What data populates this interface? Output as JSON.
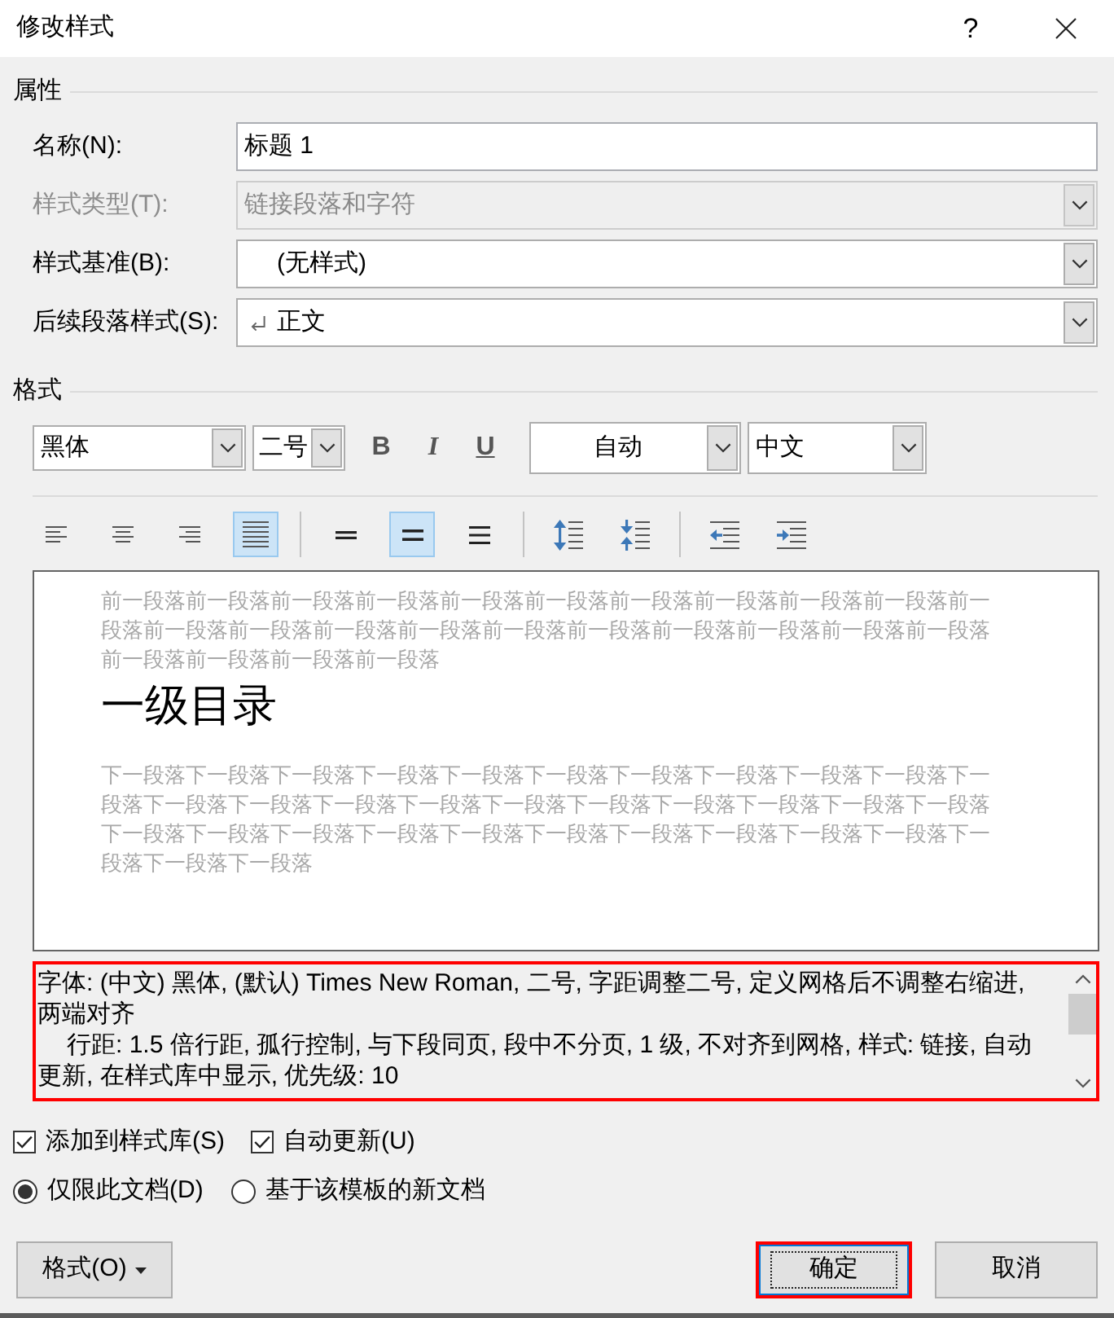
{
  "window": {
    "title": "修改样式",
    "help": "?"
  },
  "properties": {
    "heading": "属性",
    "fields": [
      {
        "kind": "text",
        "label": "名称(N):",
        "value": "标题 1",
        "disabled": false
      },
      {
        "kind": "combo",
        "label": "样式类型(T):",
        "value": "链接段落和字符",
        "disabled": true
      },
      {
        "kind": "style_combo",
        "label": "样式基准(B):",
        "value": "(无样式)",
        "disabled": false,
        "paragraph_style": false
      },
      {
        "kind": "style_combo",
        "label": "后续段落样式(S):",
        "value": "正文",
        "disabled": false,
        "paragraph_style": true
      }
    ]
  },
  "format": {
    "heading": "格式",
    "font": "黑体",
    "size": "二号",
    "styles": [
      {
        "kind": "bold",
        "label": "B",
        "selected": false
      },
      {
        "kind": "italic",
        "label": "I",
        "selected": false
      },
      {
        "kind": "underline",
        "label": "U",
        "selected": false
      }
    ],
    "font_color": "自动",
    "language": "中文",
    "alignment": [
      {
        "kind": "left",
        "selected": false
      },
      {
        "kind": "center",
        "selected": false
      },
      {
        "kind": "right",
        "selected": false
      },
      {
        "kind": "justify",
        "selected": true
      }
    ],
    "line_spacing": [
      {
        "kind": "single",
        "selected": false
      },
      {
        "kind": "one_and_half",
        "selected": true
      },
      {
        "kind": "double",
        "selected": false
      }
    ],
    "paragraph_spacing": [
      {
        "kind": "increase"
      },
      {
        "kind": "decrease"
      }
    ],
    "indent": [
      {
        "kind": "decrease"
      },
      {
        "kind": "increase"
      }
    ]
  },
  "preview": {
    "previous": "前一段落前一段落前一段落前一段落前一段落前一段落前一段落前一段落前一段落前一段落前一段落前一段落前一段落前一段落前一段落前一段落前一段落前一段落前一段落前一段落前一段落前一段落前一段落前一段落前一段落",
    "heading": "一级目录",
    "next": "下一段落下一段落下一段落下一段落下一段落下一段落下一段落下一段落下一段落下一段落下一段落下一段落下一段落下一段落下一段落下一段落下一段落下一段落下一段落下一段落下一段落下一段落下一段落下一段落下一段落下一段落下一段落下一段落下一段落下一段落下一段落下一段落下一段落下一段落"
  },
  "description": {
    "highlighted": true,
    "paragraphs": [
      "字体: (中文) 黑体, (默认) Times New Roman, 二号, 字距调整二号, 定义网格后不调整右缩进, 两端对齐",
      "行距: 1.5 倍行距, 孤行控制, 与下段同页, 段中不分页, 1 级, 不对齐到网格, 样式: 链接, 自动更新, 在样式库中显示, 优先级: 10"
    ]
  },
  "options": {
    "checkboxes": [
      {
        "label": "添加到样式库(S)",
        "checked": true
      },
      {
        "label": "自动更新(U)",
        "checked": true
      }
    ],
    "radios": [
      {
        "label": "仅限此文档(D)",
        "selected": true
      },
      {
        "label": "基于该模板的新文档",
        "selected": false
      }
    ]
  },
  "buttons": [
    {
      "kind": "menu",
      "label": "格式(O)",
      "highlighted": false
    },
    {
      "kind": "default",
      "label": "确定",
      "highlighted": true
    },
    {
      "kind": "normal",
      "label": "取消",
      "highlighted": false
    }
  ]
}
